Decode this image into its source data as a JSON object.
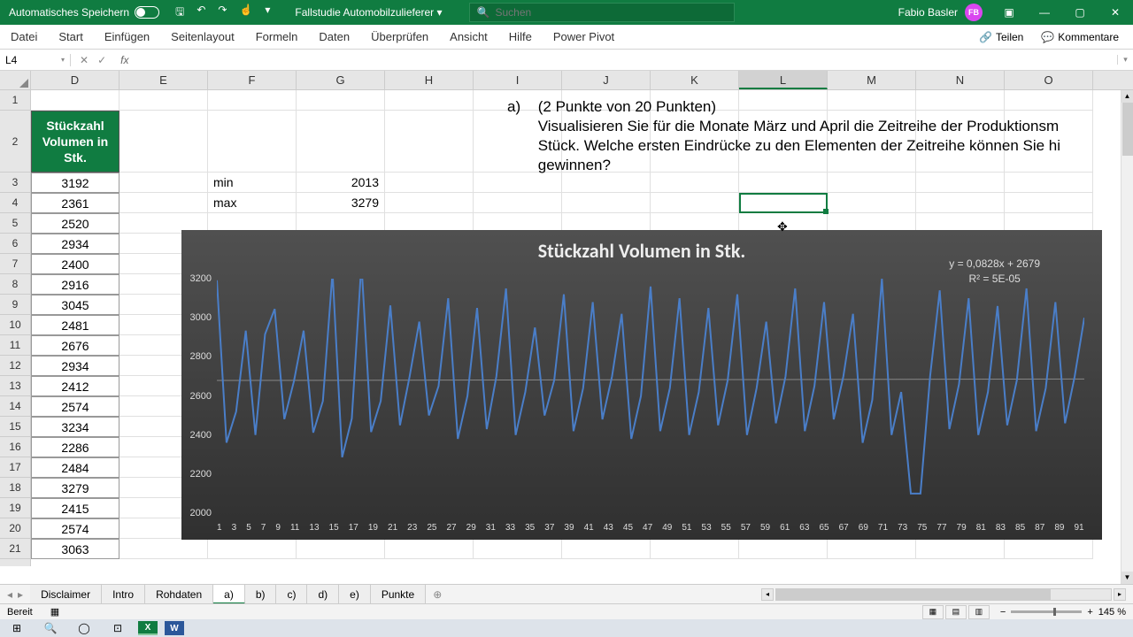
{
  "titlebar": {
    "autosave": "Automatisches Speichern",
    "docname": "Fallstudie Automobilzulieferer",
    "search_placeholder": "Suchen",
    "user_name": "Fabio Basler",
    "user_initials": "FB"
  },
  "ribbon": {
    "tabs": [
      "Datei",
      "Start",
      "Einfügen",
      "Seitenlayout",
      "Formeln",
      "Daten",
      "Überprüfen",
      "Ansicht",
      "Hilfe",
      "Power Pivot"
    ],
    "share": "Teilen",
    "comments": "Kommentare"
  },
  "fbar": {
    "cellref": "L4",
    "formula": ""
  },
  "columns": [
    "D",
    "E",
    "F",
    "G",
    "H",
    "I",
    "J",
    "K",
    "L",
    "M",
    "N",
    "O"
  ],
  "selected_col": "L",
  "row_numbers": [
    1,
    2,
    3,
    4,
    5,
    6,
    7,
    8,
    9,
    10,
    11,
    12,
    13,
    14,
    15,
    16,
    17,
    18,
    19,
    20,
    21
  ],
  "colD_header": "Stückzahl Volumen in Stk.",
  "colD": [
    3192,
    2361,
    2520,
    2934,
    2400,
    2916,
    3045,
    2481,
    2676,
    2934,
    2412,
    2574,
    3234,
    2286,
    2484,
    3279,
    2415,
    2574,
    3063
  ],
  "stats": {
    "min_label": "min",
    "min_val": 2013,
    "max_label": "max",
    "max_val": 3279
  },
  "question": {
    "marker": "a)",
    "points": "(2 Punkte von 20 Punkten)",
    "text": "Visualisieren Sie für die Monate März und April die Zeitreihe der Produktionsm Stück. Welche ersten Eindrücke zu den Elementen der Zeitreihe können Sie hi gewinnen?"
  },
  "chart_data": {
    "type": "line",
    "title": "Stückzahl Volumen in Stk.",
    "trend_eq": "y = 0,0828x + 2679",
    "trend_r2": "R² = 5E-05",
    "ylim": [
      2000,
      3200
    ],
    "yticks": [
      2000,
      2200,
      2400,
      2600,
      2800,
      3000,
      3200
    ],
    "x": [
      1,
      3,
      5,
      7,
      9,
      11,
      13,
      15,
      17,
      19,
      21,
      23,
      25,
      27,
      29,
      31,
      33,
      35,
      37,
      39,
      41,
      43,
      45,
      47,
      49,
      51,
      53,
      55,
      57,
      59,
      61,
      63,
      65,
      67,
      69,
      71,
      73,
      75,
      77,
      79,
      81,
      83,
      85,
      87,
      89,
      91
    ],
    "values": [
      3192,
      2361,
      2520,
      2934,
      2400,
      2916,
      3045,
      2481,
      2676,
      2934,
      2412,
      2574,
      3234,
      2286,
      2484,
      3279,
      2415,
      2574,
      3063,
      2450,
      2700,
      2980,
      2500,
      2650,
      3100,
      2380,
      2600,
      3050,
      2430,
      2700,
      3150,
      2400,
      2620,
      2950,
      2500,
      2680,
      3120,
      2420,
      2640,
      3080,
      2480,
      2700,
      3020,
      2380,
      2600,
      3160,
      2420,
      2640,
      3100,
      2400,
      2620,
      3050,
      2450,
      2680,
      3120,
      2400,
      2640,
      2980,
      2460,
      2700,
      3150,
      2420,
      2650,
      3080,
      2480,
      2700,
      3020,
      2360,
      2580,
      3200,
      2400,
      2620,
      2100,
      2100,
      2700,
      3140,
      2430,
      2660,
      3100,
      2400,
      2620,
      3060,
      2450,
      2680,
      3150,
      2420,
      2640,
      3080,
      2460,
      2700,
      3000
    ],
    "trendline": {
      "slope": 0.0828,
      "intercept": 2679
    }
  },
  "sheets": [
    "Disclaimer",
    "Intro",
    "Rohdaten",
    "a)",
    "b)",
    "c)",
    "d)",
    "e)",
    "Punkte"
  ],
  "active_sheet": "a)",
  "status": {
    "ready": "Bereit",
    "zoom": "145 %"
  }
}
